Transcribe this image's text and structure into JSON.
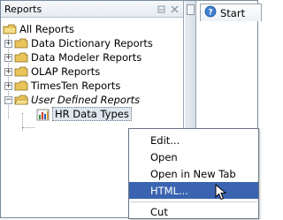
{
  "panel": {
    "title": "Reports",
    "tree": [
      {
        "label": "All Reports",
        "expanded": true,
        "italic": false
      },
      {
        "label": "Data Dictionary Reports",
        "expanded": false,
        "italic": false
      },
      {
        "label": "Data Modeler Reports",
        "expanded": false,
        "italic": false
      },
      {
        "label": "OLAP Reports",
        "expanded": false,
        "italic": false
      },
      {
        "label": "TimesTen Reports",
        "expanded": false,
        "italic": false
      },
      {
        "label": "User Defined Reports",
        "expanded": true,
        "italic": true
      },
      {
        "label": "HR Data Types",
        "selected": true
      }
    ]
  },
  "editor": {
    "tab_label": "Start"
  },
  "context_menu": {
    "items": [
      "Edit...",
      "Open",
      "Open in New Tab",
      "HTML...",
      "Cut"
    ],
    "highlighted": "HTML..."
  },
  "colors": {
    "menu_highlight": "#3a64b0",
    "folder": "#e8c45a",
    "panel_border": "#9aa6b2"
  },
  "icons": [
    "folder-icon",
    "report-chart-icon",
    "start-page-icon",
    "minimize-icon",
    "close-icon",
    "mouse-pointer-icon"
  ]
}
